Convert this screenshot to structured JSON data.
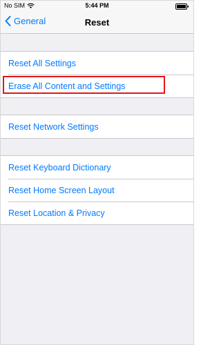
{
  "status_bar": {
    "carrier": "No SIM",
    "time": "5:44 PM",
    "wifi_icon": "wifi-icon",
    "battery_icon": "battery-icon"
  },
  "nav": {
    "back_label": "General",
    "back_icon": "chevron-left-icon",
    "title": "Reset"
  },
  "groups": [
    {
      "items": [
        "Reset All Settings",
        "Erase All Content and Settings"
      ]
    },
    {
      "items": [
        "Reset Network Settings"
      ]
    },
    {
      "items": [
        "Reset Keyboard Dictionary",
        "Reset Home Screen Layout",
        "Reset Location & Privacy"
      ]
    }
  ],
  "highlighted_item": "Erase All Content and Settings",
  "colors": {
    "accent": "#007aff",
    "highlight": "#e0161a",
    "background": "#efeff4"
  }
}
